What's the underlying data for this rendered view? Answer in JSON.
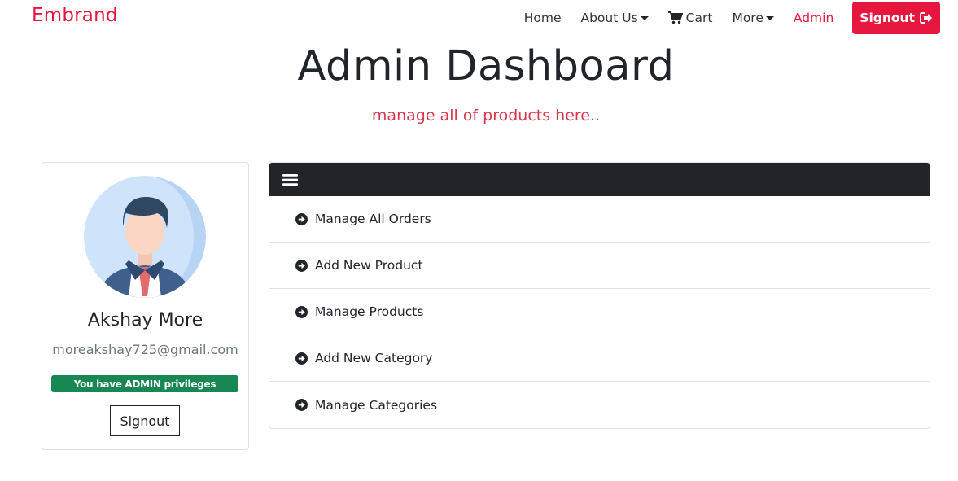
{
  "navbar": {
    "brand": "Embrand",
    "links": {
      "home": "Home",
      "about": "About Us",
      "cart": "Cart",
      "more": "More",
      "admin": "Admin"
    },
    "signout_label": "Signout",
    "brand_color": "#e5173f"
  },
  "header": {
    "title": "Admin Dashboard",
    "subtitle": "manage all of products here.."
  },
  "profile": {
    "name": "Akshay More",
    "email": "moreakshay725@gmail.com",
    "badge": "You have ADMIN privileges",
    "signout_label": "Signout",
    "avatar_icon": "user-avatar-icon"
  },
  "menu": {
    "toggle_icon": "hamburger-icon",
    "items": [
      {
        "label": "Manage All Orders"
      },
      {
        "label": "Add New Product"
      },
      {
        "label": "Manage Products"
      },
      {
        "label": "Add New Category"
      },
      {
        "label": "Manage Categories"
      }
    ]
  },
  "colors": {
    "accent": "#e5173f",
    "badge": "#198754",
    "dark": "#212529"
  }
}
